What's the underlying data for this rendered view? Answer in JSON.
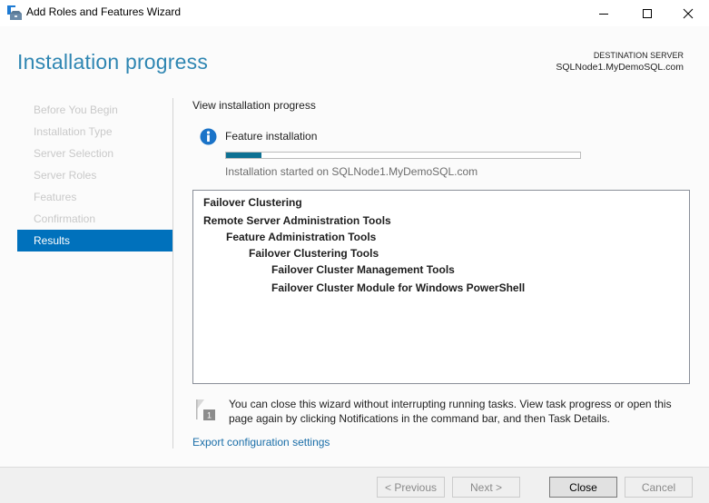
{
  "window": {
    "title": "Add Roles and Features Wizard",
    "icons": {
      "app": "server-manager-wizard-icon",
      "minimize": "minimize-icon",
      "maximize": "maximize-icon",
      "close": "close-icon"
    }
  },
  "header": {
    "page_title": "Installation progress",
    "destination_label": "DESTINATION SERVER",
    "destination_server": "SQLNode1.MyDemoSQL.com"
  },
  "nav": {
    "items": [
      {
        "label": "Before You Begin",
        "active": false
      },
      {
        "label": "Installation Type",
        "active": false
      },
      {
        "label": "Server Selection",
        "active": false
      },
      {
        "label": "Server Roles",
        "active": false
      },
      {
        "label": "Features",
        "active": false
      },
      {
        "label": "Confirmation",
        "active": false
      },
      {
        "label": "Results",
        "active": true
      }
    ],
    "active_color": "#0071bc"
  },
  "content": {
    "heading": "View installation progress",
    "task": {
      "icon": "info-icon",
      "name": "Feature installation",
      "progress_percent": 10,
      "status": "Installation started on SQLNode1.MyDemoSQL.com",
      "progress_color": "#0e7193"
    },
    "results": [
      {
        "text": "Failover Clustering",
        "level": 0
      },
      {
        "text": "Remote Server Administration Tools",
        "level": 0
      },
      {
        "text": "Feature Administration Tools",
        "level": 1
      },
      {
        "text": "Failover Clustering Tools",
        "level": 2
      },
      {
        "text": "Failover Cluster Management Tools",
        "level": 3
      },
      {
        "text": "Failover Cluster Module for Windows PowerShell",
        "level": 3
      }
    ],
    "note": {
      "icon": "notification-flag-icon",
      "badge": "1",
      "text": "You can close this wizard without interrupting running tasks. View task progress or open this page again by clicking Notifications in the command bar, and then Task Details."
    },
    "export_link": "Export configuration settings"
  },
  "footer": {
    "previous_label": "< Previous",
    "next_label": "Next >",
    "close_label": "Close",
    "cancel_label": "Cancel"
  }
}
